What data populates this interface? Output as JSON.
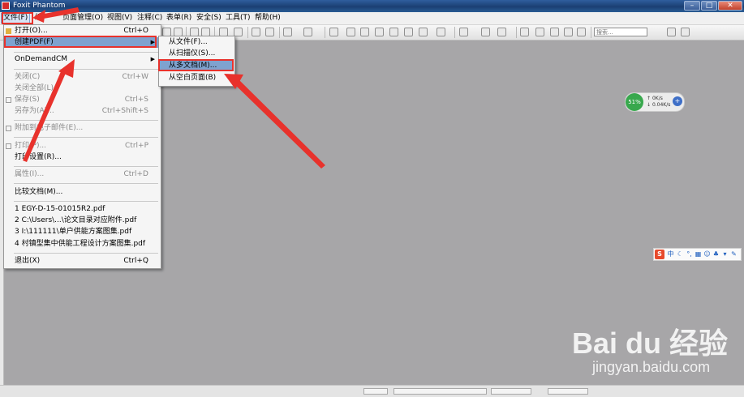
{
  "window": {
    "title": "Foxit Phantom",
    "minimize": "–",
    "maximize": "□",
    "close": "✕"
  },
  "menubar": [
    {
      "label": "文件(F)"
    },
    {
      "label": "编"
    },
    {
      "label": "页面管理(O)"
    },
    {
      "label": "视图(V)"
    },
    {
      "label": "注释(C)"
    },
    {
      "label": "表单(R)"
    },
    {
      "label": "安全(S)"
    },
    {
      "label": "工具(T)"
    },
    {
      "label": "帮助(H)"
    }
  ],
  "toolbar": {
    "search_placeholder": "搜索..."
  },
  "file_menu": {
    "items": [
      {
        "label": "打开(O)...",
        "shortcut": "Ctrl+O"
      },
      {
        "label": "创建PDF(F)",
        "has_submenu": true
      },
      {
        "label": "OnDemandCM",
        "has_submenu": true
      },
      {
        "label": "关闭(C)",
        "shortcut": "Ctrl+W"
      },
      {
        "label": "关闭全部(L)"
      },
      {
        "label": "保存(S)",
        "shortcut": "Ctrl+S"
      },
      {
        "label": "另存为(A)...",
        "shortcut": "Ctrl+Shift+S"
      },
      {
        "label": "附加到电子邮件(E)..."
      },
      {
        "label": "打印(P)...",
        "shortcut": "Ctrl+P"
      },
      {
        "label": "打印设置(R)..."
      },
      {
        "label": "属性(I)...",
        "shortcut": "Ctrl+D"
      },
      {
        "label": "比较文档(M)..."
      },
      {
        "label": "1 EGY-D-15-01015R2.pdf"
      },
      {
        "label": "2 C:\\Users\\...\\论文目录对应附件.pdf"
      },
      {
        "label": "3 I:\\111111\\单户供能方案图集.pdf"
      },
      {
        "label": "4 村镇型集中供能工程设计方案图集.pdf"
      },
      {
        "label": "退出(X)",
        "shortcut": "Ctrl+Q"
      }
    ]
  },
  "create_pdf_submenu": {
    "items": [
      {
        "label": "从文件(F)..."
      },
      {
        "label": "从扫描仪(S)..."
      },
      {
        "label": "从多文档(M)..."
      },
      {
        "label": "从空白页面(B)"
      }
    ]
  },
  "net_widget": {
    "percent": "51%",
    "up": "0K/s",
    "down": "0.04K/s",
    "plus": "+"
  },
  "ime_bar": {
    "logo": "S",
    "mode": "中"
  },
  "watermark": {
    "logo": "Bai du 经验",
    "url": "jingyan.baidu.com"
  },
  "colors": {
    "highlight": "#7fa2cf",
    "annotation_red": "#e8322c",
    "workspace": "#a7a6a8"
  }
}
